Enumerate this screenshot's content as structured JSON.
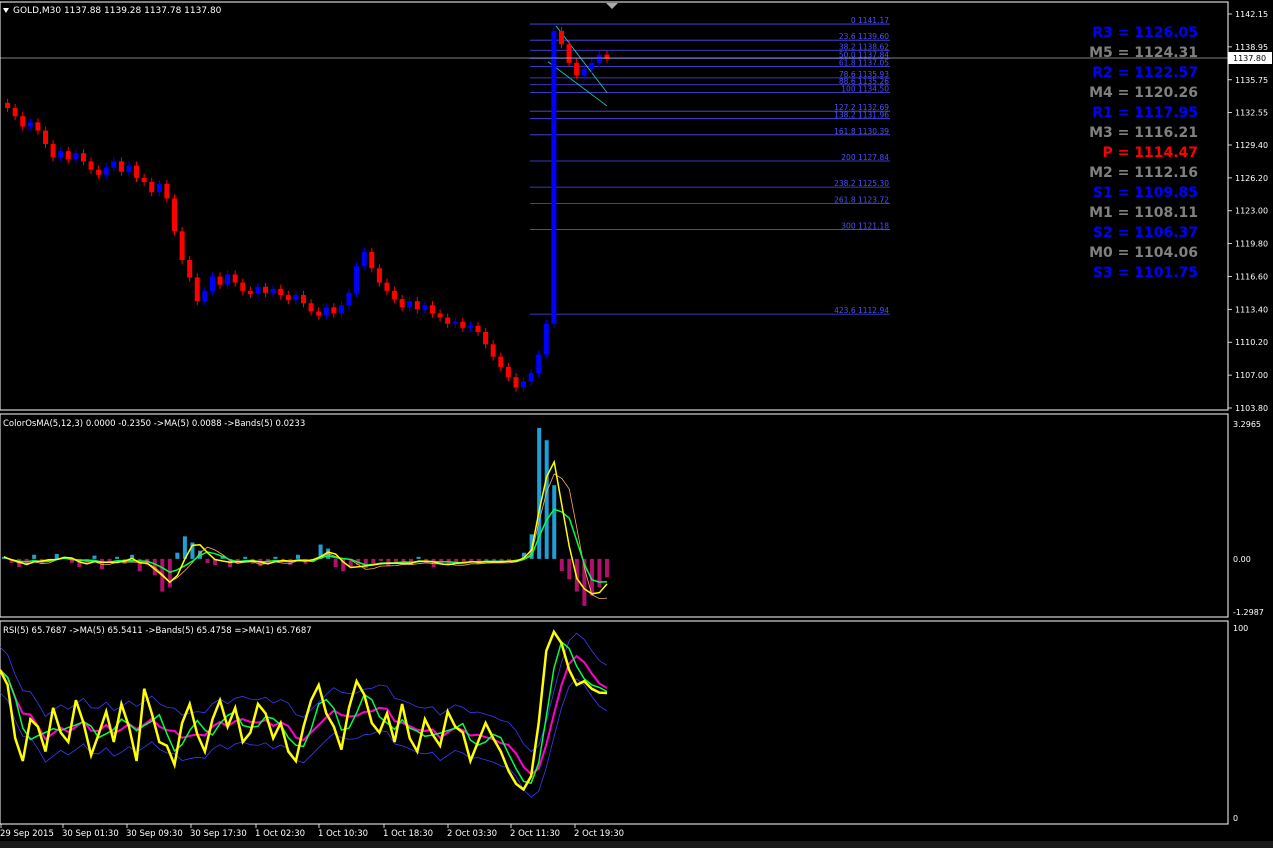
{
  "colors": {
    "background": "#000000",
    "grid": "#ffffff",
    "bull": "#0000ff",
    "bear": "#ff0000",
    "fib": "#4d4dff",
    "pivot_blue": "#0000ff",
    "pivot_gray": "#808080",
    "pivot_red": "#ff0000",
    "osma_pos": "#1f9fd8",
    "osma_neg": "#b0106c",
    "line_green": "#00ff44",
    "line_yellow": "#ffff00",
    "line_pink": "#ff00d0",
    "line_band": "#3a3aff",
    "line_orange": "#ffb060"
  },
  "main": {
    "header": "GOLD,M30  1137.88 1139.28 1137.78 1137.80",
    "current_price": "1137.80",
    "price_scale": [
      "1142.15",
      "1138.95",
      "1135.75",
      "1132.55",
      "1129.40",
      "1126.20",
      "1123.00",
      "1119.80",
      "1116.60",
      "1113.40",
      "1110.20",
      "1107.00",
      "1103.80"
    ],
    "fib_levels": [
      {
        "label": "0 1141.17",
        "price": 1141.17
      },
      {
        "label": "23.6 1139.60",
        "price": 1139.6
      },
      {
        "label": "38.2 1138.62",
        "price": 1138.62
      },
      {
        "label": "50.0 1137.84",
        "price": 1137.84
      },
      {
        "label": "61.8 1137.05",
        "price": 1137.05
      },
      {
        "label": "78.6 1135.93",
        "price": 1135.93
      },
      {
        "label": "88.6 1135.26",
        "price": 1135.26
      },
      {
        "label": "100 1134.50",
        "price": 1134.5
      },
      {
        "label": "127.2 1132.69",
        "price": 1132.69
      },
      {
        "label": "138.2 1131.96",
        "price": 1131.96
      },
      {
        "label": "161.8 1130.39",
        "price": 1130.39
      },
      {
        "label": "200 1127.84",
        "price": 1127.84
      },
      {
        "label": "238.2 1125.30",
        "price": 1125.3
      },
      {
        "label": "261.8 1123.72",
        "price": 1123.72
      },
      {
        "label": "300 1121.18",
        "price": 1121.18
      },
      {
        "label": "423.6 1112.94",
        "price": 1112.94
      }
    ],
    "pivots": [
      {
        "label": "R3 = 1126.05",
        "color": "blue"
      },
      {
        "label": "M5 = 1124.31",
        "color": "gray"
      },
      {
        "label": "R2 = 1122.57",
        "color": "blue"
      },
      {
        "label": "M4 = 1120.26",
        "color": "gray"
      },
      {
        "label": "R1 = 1117.95",
        "color": "blue"
      },
      {
        "label": "M3 = 1116.21",
        "color": "gray"
      },
      {
        "label": "P  = 1114.47",
        "color": "red"
      },
      {
        "label": "M2 = 1112.16",
        "color": "gray"
      },
      {
        "label": "S1 = 1109.85",
        "color": "blue"
      },
      {
        "label": "M1 = 1108.11",
        "color": "gray"
      },
      {
        "label": "S2 = 1106.37",
        "color": "blue"
      },
      {
        "label": "M0 = 1104.06",
        "color": "gray"
      },
      {
        "label": "S3 = 1101.75",
        "color": "blue"
      }
    ],
    "price_path": [
      1133.5,
      1133.0,
      1132.2,
      1131.2,
      1131.6,
      1130.8,
      1129.5,
      1128.2,
      1128.8,
      1128.0,
      1128.6,
      1127.8,
      1127.0,
      1126.5,
      1127.2,
      1127.8,
      1126.8,
      1127.4,
      1126.2,
      1125.8,
      1124.8,
      1125.6,
      1124.2,
      1121.0,
      1118.2,
      1116.5,
      1114.2,
      1115.2,
      1116.6,
      1115.8,
      1116.8,
      1116.0,
      1115.2,
      1114.9,
      1115.6,
      1115.0,
      1115.4,
      1114.8,
      1114.3,
      1114.8,
      1114.0,
      1113.2,
      1112.8,
      1113.6,
      1113.0,
      1113.8,
      1115.0,
      1117.6,
      1119.0,
      1117.4,
      1116.0,
      1115.2,
      1114.4,
      1113.6,
      1114.2,
      1113.4,
      1113.8,
      1113.0,
      1112.6,
      1112.0,
      1112.2,
      1111.6,
      1111.8,
      1111.2,
      1110.0,
      1108.8,
      1107.8,
      1106.8,
      1105.8,
      1106.4,
      1107.2,
      1109.0,
      1112.0,
      1140.5,
      1139.2,
      1137.4,
      1136.2,
      1136.8,
      1137.4,
      1138.2,
      1137.8
    ]
  },
  "osma": {
    "header": "ColorOsMA(5,12,3) 0.0000 -0.2350  ->MA(5) 0.0088  ->Bands(5) 0.0233",
    "scale": [
      "3.2965",
      "0.00",
      "-1.2987"
    ],
    "values": [
      0.05,
      -0.1,
      -0.2,
      -0.15,
      0.1,
      -0.12,
      -0.05,
      0.12,
      0.05,
      -0.1,
      -0.2,
      -0.1,
      0.08,
      -0.25,
      -0.1,
      0.05,
      -0.12,
      0.1,
      -0.3,
      -0.15,
      -0.4,
      -0.8,
      -0.7,
      0.15,
      0.55,
      0.4,
      0.2,
      -0.1,
      -0.15,
      0.08,
      -0.2,
      -0.1,
      0.05,
      -0.12,
      -0.18,
      -0.1,
      0.05,
      -0.08,
      -0.15,
      0.1,
      -0.12,
      -0.05,
      0.35,
      0.25,
      -0.2,
      -0.3,
      -0.2,
      -0.15,
      -0.22,
      -0.12,
      -0.05,
      -0.18,
      -0.12,
      -0.08,
      -0.15,
      0.05,
      -0.1,
      -0.2,
      -0.12,
      -0.15,
      -0.08,
      -0.1,
      -0.05,
      -0.12,
      -0.08,
      -0.05,
      -0.1,
      -0.05,
      -0.02,
      0.15,
      0.6,
      3.2,
      2.9,
      1.8,
      -0.3,
      -0.5,
      -0.8,
      -1.15,
      -0.9,
      -0.7,
      -0.45
    ]
  },
  "rsi": {
    "header": "RSI(5) 65.7687  ->MA(5) 65.5411  ->Bands(5) 65.4758  =>MA(1) 65.7687",
    "scale": [
      "100",
      "0"
    ],
    "values": [
      78,
      70,
      42,
      30,
      52,
      48,
      35,
      58,
      45,
      40,
      62,
      50,
      33,
      44,
      56,
      40,
      60,
      48,
      30,
      68,
      55,
      40,
      38,
      28,
      50,
      60,
      44,
      35,
      52,
      62,
      48,
      58,
      40,
      45,
      60,
      55,
      42,
      50,
      35,
      30,
      48,
      62,
      70,
      55,
      48,
      36,
      58,
      72,
      65,
      50,
      45,
      55,
      40,
      60,
      42,
      35,
      52,
      44,
      38,
      56,
      48,
      45,
      30,
      40,
      50,
      42,
      35,
      25,
      18,
      15,
      22,
      50,
      88,
      98,
      92,
      78,
      70,
      72,
      68,
      66,
      65.8
    ]
  },
  "time_labels": [
    "29 Sep 2015",
    "30 Sep 01:30",
    "30 Sep 09:30",
    "30 Sep 17:30",
    "1 Oct 02:30",
    "1 Oct 10:30",
    "1 Oct 18:30",
    "2 Oct 03:30",
    "2 Oct 11:30",
    "2 Oct 19:30"
  ]
}
